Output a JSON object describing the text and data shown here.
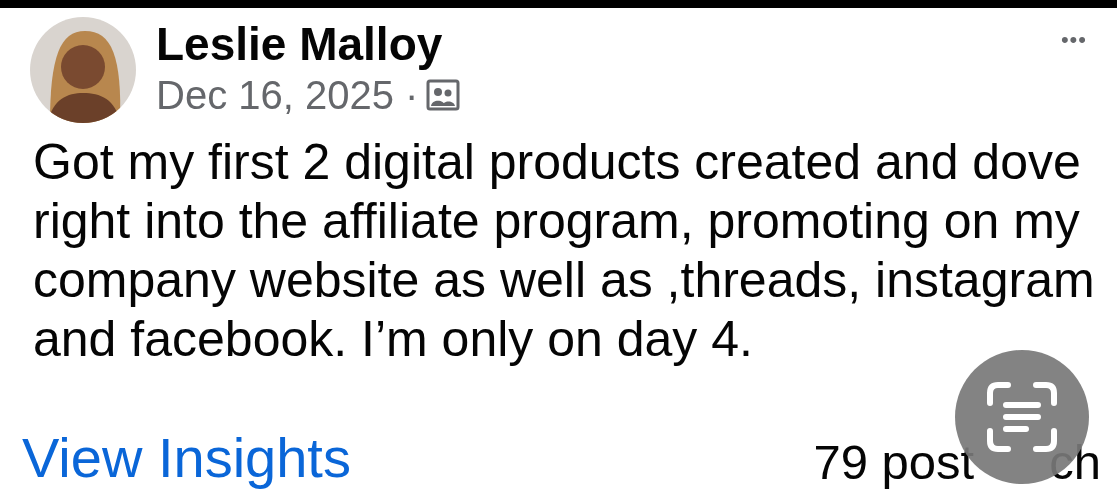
{
  "post": {
    "author": "Leslie Malloy",
    "date": "Dec 16, 2025 ·",
    "more": "•••",
    "text": "Got my first 2 digital products created and dove right into the affiliate program, promoting on my company website as well as ,threads, instagram and facebook. I’m only on day 4."
  },
  "footer": {
    "insights_link": "View Insights",
    "reach": "79 post",
    "reach_tail": "ch"
  }
}
